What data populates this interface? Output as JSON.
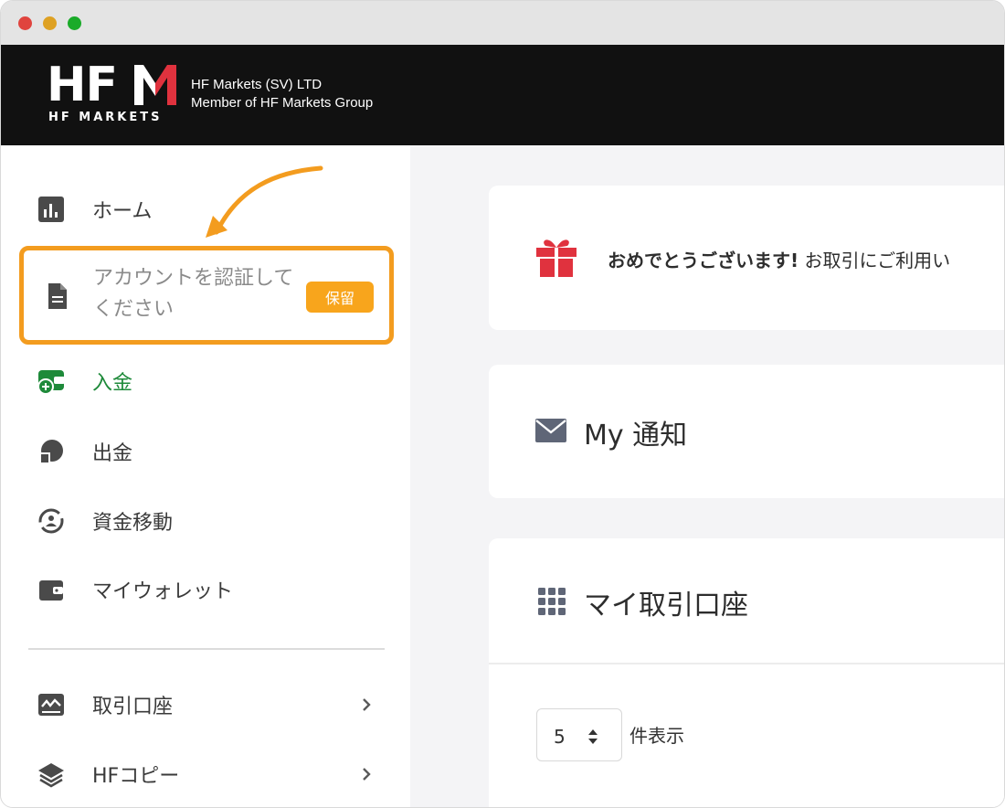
{
  "header": {
    "logo_letters": "HF",
    "logo_sub": "HF MARKETS",
    "company_line1": "HF Markets (SV) LTD",
    "company_line2": "Member of HF Markets Group"
  },
  "sidebar": {
    "items": [
      {
        "label": "ホーム",
        "icon": "bar-chart-icon"
      },
      {
        "label": "アカウントを認証してください",
        "icon": "document-icon",
        "badge": "保留"
      },
      {
        "label": "入金",
        "icon": "wallet-plus-icon"
      },
      {
        "label": "出金",
        "icon": "withdraw-icon"
      },
      {
        "label": "資金移動",
        "icon": "transfer-icon"
      },
      {
        "label": "マイウォレット",
        "icon": "wallet-icon"
      },
      {
        "label": "取引口座",
        "icon": "trading-chart-icon"
      },
      {
        "label": "HFコピー",
        "icon": "layers-icon"
      }
    ]
  },
  "main": {
    "notice_bold": "おめでとうございます!",
    "notice_text": " お取引にご利用い",
    "notifications_title": "My 通知",
    "accounts_title": "マイ取引口座",
    "page_size_value": "5",
    "page_size_label": "件表示"
  },
  "colors": {
    "accent_orange": "#f39c1f",
    "badge": "#f8a51c",
    "deposit_green": "#1e8a3a",
    "gift_red": "#e0323e"
  }
}
